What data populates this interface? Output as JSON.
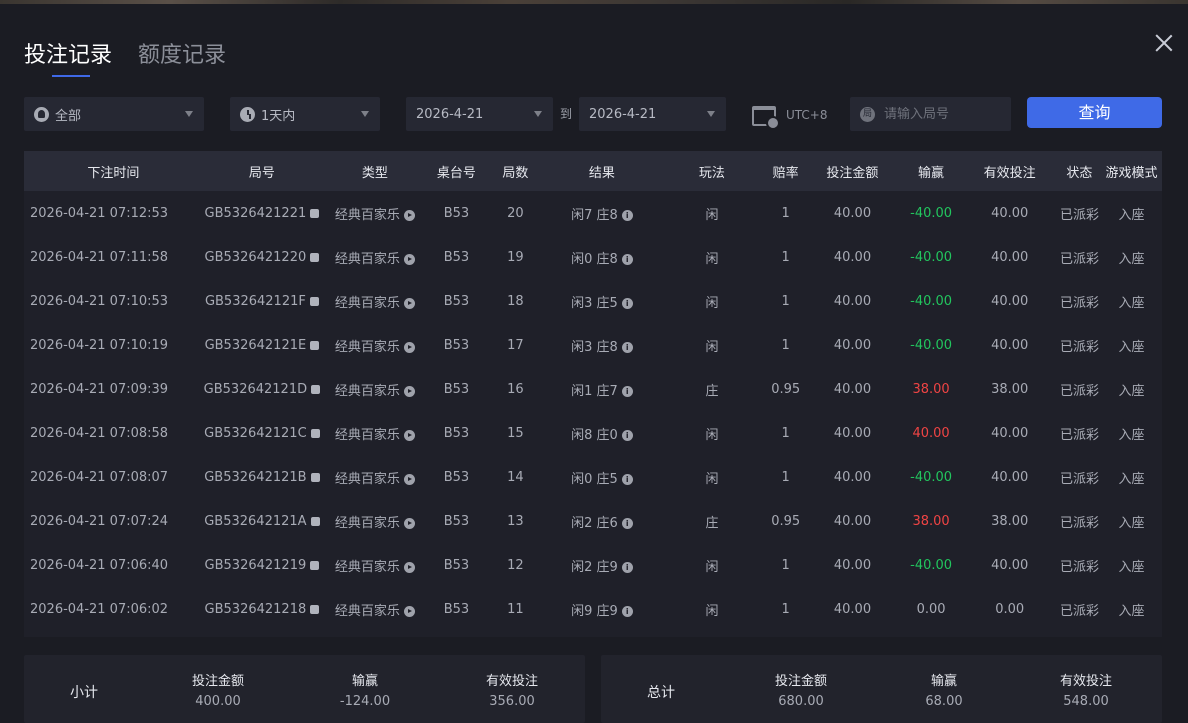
{
  "tabs": [
    {
      "label": "投注记录"
    },
    {
      "label": "额度记录"
    }
  ],
  "filters": {
    "game": "全部",
    "period": "1天内",
    "date_from": "2026-4-21",
    "to_label": "到",
    "date_to": "2026-4-21",
    "timezone": "UTC+8",
    "round_placeholder": "请输入局号",
    "query_label": "查询"
  },
  "columns": [
    "下注时间",
    "局号",
    "类型",
    "桌台号",
    "局数",
    "结果",
    "玩法",
    "赔率",
    "投注金额",
    "输赢",
    "有效投注",
    "状态",
    "游戏模式"
  ],
  "rows": [
    {
      "time": "2026-04-21 07:12:53",
      "round": "GB5326421221",
      "type": "经典百家乐",
      "table": "B53",
      "count": "20",
      "result": "闲7 庄8",
      "play": "闲",
      "odds": "1",
      "bet": "40.00",
      "winloss": "-40.00",
      "wl": "win",
      "valid": "40.00",
      "status": "已派彩",
      "mode": "入座"
    },
    {
      "time": "2026-04-21 07:11:58",
      "round": "GB5326421220",
      "type": "经典百家乐",
      "table": "B53",
      "count": "19",
      "result": "闲0 庄8",
      "play": "闲",
      "odds": "1",
      "bet": "40.00",
      "winloss": "-40.00",
      "wl": "win",
      "valid": "40.00",
      "status": "已派彩",
      "mode": "入座"
    },
    {
      "time": "2026-04-21 07:10:53",
      "round": "GB532642121F",
      "type": "经典百家乐",
      "table": "B53",
      "count": "18",
      "result": "闲3 庄5",
      "play": "闲",
      "odds": "1",
      "bet": "40.00",
      "winloss": "-40.00",
      "wl": "win",
      "valid": "40.00",
      "status": "已派彩",
      "mode": "入座"
    },
    {
      "time": "2026-04-21 07:10:19",
      "round": "GB532642121E",
      "type": "经典百家乐",
      "table": "B53",
      "count": "17",
      "result": "闲3 庄8",
      "play": "闲",
      "odds": "1",
      "bet": "40.00",
      "winloss": "-40.00",
      "wl": "win",
      "valid": "40.00",
      "status": "已派彩",
      "mode": "入座"
    },
    {
      "time": "2026-04-21 07:09:39",
      "round": "GB532642121D",
      "type": "经典百家乐",
      "table": "B53",
      "count": "16",
      "result": "闲1 庄7",
      "play": "庄",
      "odds": "0.95",
      "bet": "40.00",
      "winloss": "38.00",
      "wl": "lose",
      "valid": "38.00",
      "status": "已派彩",
      "mode": "入座"
    },
    {
      "time": "2026-04-21 07:08:58",
      "round": "GB532642121C",
      "type": "经典百家乐",
      "table": "B53",
      "count": "15",
      "result": "闲8 庄0",
      "play": "闲",
      "odds": "1",
      "bet": "40.00",
      "winloss": "40.00",
      "wl": "lose",
      "valid": "40.00",
      "status": "已派彩",
      "mode": "入座"
    },
    {
      "time": "2026-04-21 07:08:07",
      "round": "GB532642121B",
      "type": "经典百家乐",
      "table": "B53",
      "count": "14",
      "result": "闲0 庄5",
      "play": "闲",
      "odds": "1",
      "bet": "40.00",
      "winloss": "-40.00",
      "wl": "win",
      "valid": "40.00",
      "status": "已派彩",
      "mode": "入座"
    },
    {
      "time": "2026-04-21 07:07:24",
      "round": "GB532642121A",
      "type": "经典百家乐",
      "table": "B53",
      "count": "13",
      "result": "闲2 庄6",
      "play": "庄",
      "odds": "0.95",
      "bet": "40.00",
      "winloss": "38.00",
      "wl": "lose",
      "valid": "38.00",
      "status": "已派彩",
      "mode": "入座"
    },
    {
      "time": "2026-04-21 07:06:40",
      "round": "GB5326421219",
      "type": "经典百家乐",
      "table": "B53",
      "count": "12",
      "result": "闲2 庄9",
      "play": "闲",
      "odds": "1",
      "bet": "40.00",
      "winloss": "-40.00",
      "wl": "win",
      "valid": "40.00",
      "status": "已派彩",
      "mode": "入座"
    },
    {
      "time": "2026-04-21 07:06:02",
      "round": "GB5326421218",
      "type": "经典百家乐",
      "table": "B53",
      "count": "11",
      "result": "闲9 庄9",
      "play": "闲",
      "odds": "1",
      "bet": "40.00",
      "winloss": "0.00",
      "wl": "",
      "valid": "0.00",
      "status": "已派彩",
      "mode": "入座"
    }
  ],
  "subtotal": {
    "title": "小计",
    "bet_label": "投注金额",
    "bet": "400.00",
    "wl_label": "输赢",
    "wl": "-124.00",
    "valid_label": "有效投注",
    "valid": "356.00"
  },
  "total": {
    "title": "总计",
    "bet_label": "投注金额",
    "bet": "680.00",
    "wl_label": "输赢",
    "wl": "68.00",
    "valid_label": "有效投注",
    "valid": "548.00"
  },
  "colors": {
    "accent": "#3f6ae7",
    "positive": "#22c55e",
    "negative": "#ef4444"
  }
}
